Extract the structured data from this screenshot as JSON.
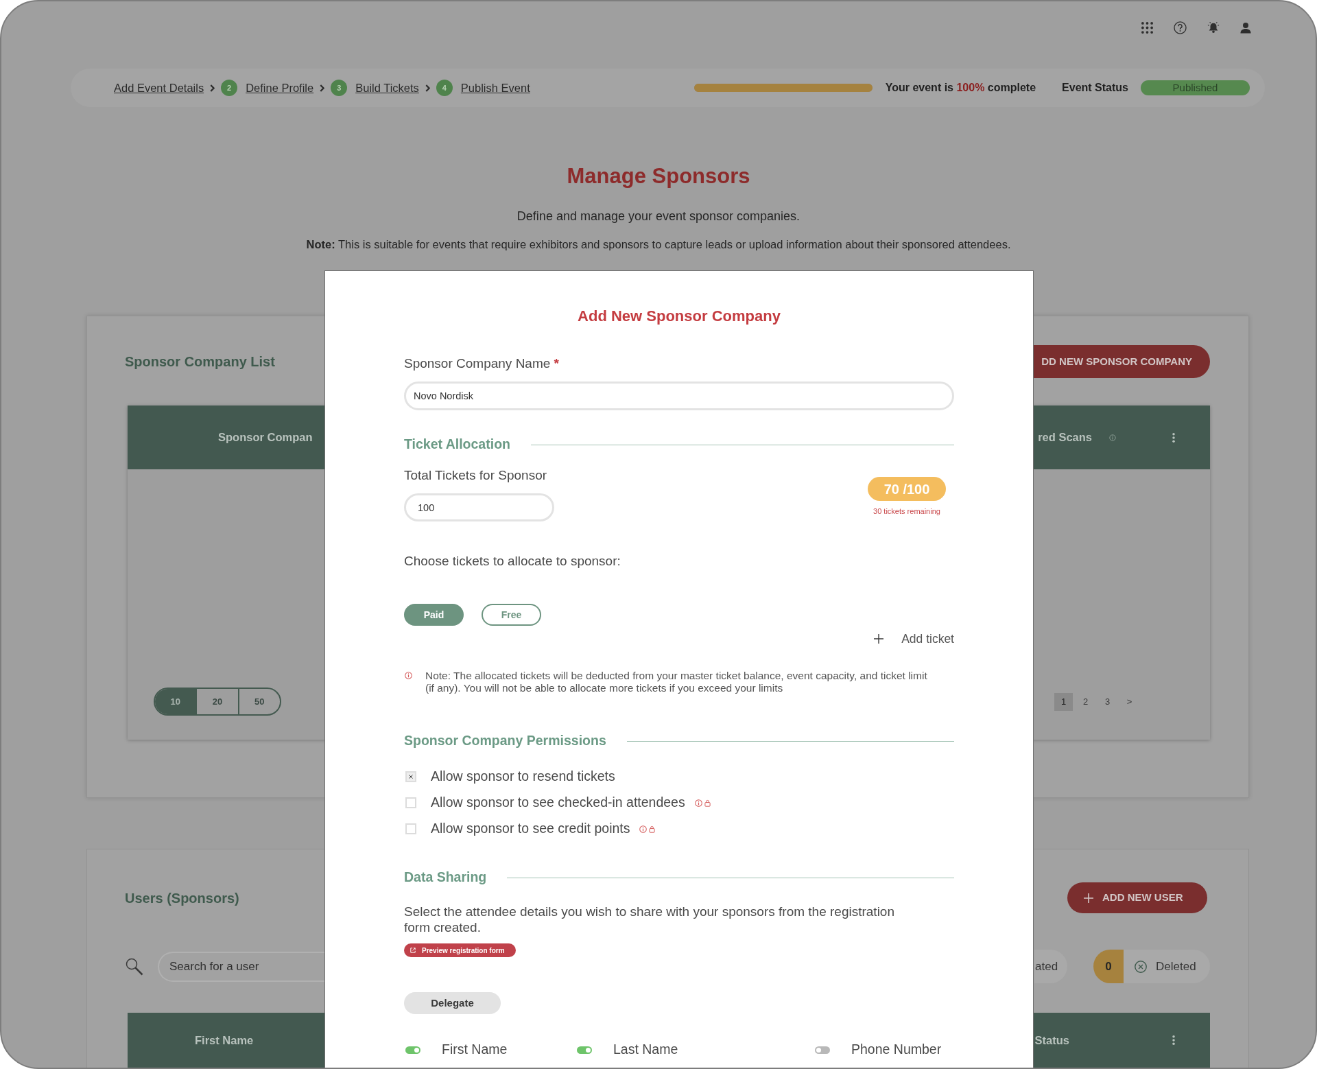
{
  "header": {
    "breadcrumb": [
      {
        "label": "Add Event Details"
      },
      {
        "number": "2",
        "label": "Define Profile"
      },
      {
        "number": "3",
        "label": "Build Tickets"
      },
      {
        "number": "4",
        "label": "Publish Event"
      }
    ],
    "progress": {
      "level": 1
    },
    "completion": {
      "prefix": "Your event is",
      "value": "100%",
      "suffix": "complete"
    },
    "event_status": {
      "label": "Event Status",
      "value": "Published"
    }
  },
  "page": {
    "title": "Manage Sponsors",
    "subtitle": "Define and manage your event sponsor companies.",
    "note": "**Note:** This is suitable for events that require exhibitors and sponsors to capture leads or upload information about their sponsored attendees."
  },
  "sponsor_company_list": {
    "title": "Sponsor Company List",
    "add_button": "DD NEW SPONSOR COMPANY",
    "columns": [
      "Sponsor Compan",
      "red Scans"
    ],
    "page_sizes": [
      {
        "label": "10",
        "selected": true
      },
      {
        "label": "20",
        "selected": false
      },
      {
        "label": "50",
        "selected": false
      }
    ],
    "pages": [
      {
        "label": "1",
        "selected": true
      },
      {
        "label": "2",
        "selected": false
      },
      {
        "label": "3",
        "selected": false
      },
      {
        "label": ">",
        "selected": false
      }
    ]
  },
  "users": {
    "title": "Users (Sponsors)",
    "add_button": "ADD NEW USER",
    "search": {
      "placeholder": "Search for a user"
    },
    "filters": [
      {
        "kind": "plain",
        "label": "ated"
      },
      {
        "kind": "counted",
        "count": "0",
        "label": "Deleted"
      }
    ],
    "columns": [
      "First Name",
      "Status"
    ]
  },
  "modal": {
    "title": "Add New Sponsor Company",
    "company_name": {
      "label": "Sponsor Company Name",
      "required_mark": "*",
      "value": "Novo Nordisk"
    },
    "ticket_allocation": {
      "heading": "Ticket Allocation",
      "total_label": "Total Tickets for Sponsor",
      "total_value": "100",
      "allocated": "70 /100",
      "remaining": "30 tickets remaining",
      "choose_label": "Choose tickets to allocate to sponsor:",
      "ticket_types": [
        {
          "label": "Paid",
          "selected": true
        },
        {
          "label": "Free",
          "selected": false
        }
      ],
      "add_ticket": "Add ticket",
      "note": "Note: The allocated tickets will be deducted from your master ticket balance, event capacity, and ticket limit (if any). You will not be able to allocate more tickets if you exceed your limits"
    },
    "permissions": {
      "heading": "Sponsor Company Permissions",
      "items": [
        {
          "label": "Allow sponsor to resend tickets",
          "checked": true,
          "locked": false
        },
        {
          "label": "Allow sponsor to see checked-in attendees",
          "checked": false,
          "locked": true
        },
        {
          "label": "Allow sponsor to see credit points",
          "checked": false,
          "locked": true
        }
      ]
    },
    "data_sharing": {
      "heading": "Data Sharing",
      "description": "Select the attendee details you wish to share with your sponsors from the registration form created.",
      "preview_button": "Preview registration form",
      "group_button": "Delegate",
      "fields": [
        {
          "label": "First Name",
          "on": true
        },
        {
          "label": "Last Name",
          "on": true
        },
        {
          "label": "Phone Number",
          "on": false
        }
      ]
    }
  }
}
